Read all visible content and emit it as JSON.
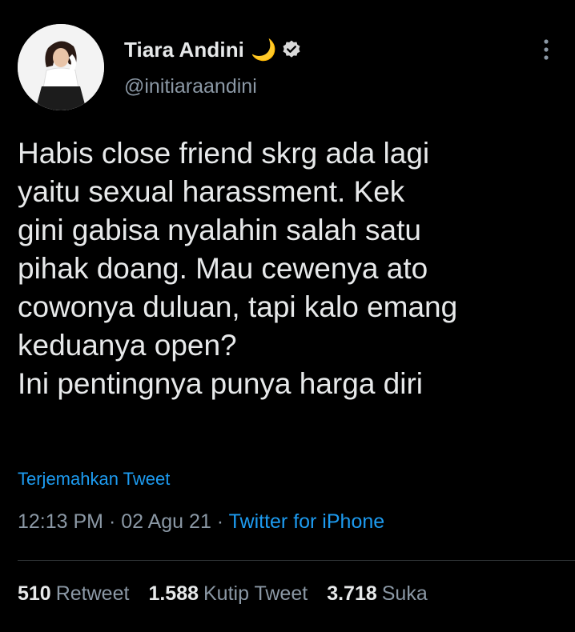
{
  "author": {
    "display_name": "Tiara Andini",
    "emoji": "🌙",
    "handle": "@initiaraandini"
  },
  "tweet": {
    "lines": [
      "Habis close friend skrg ada lagi",
      "yaitu sexual harassment. Kek",
      "gini gabisa nyalahin salah satu",
      "pihak doang. Mau cewenya ato",
      "cowonya duluan, tapi kalo emang",
      "keduanya open?",
      "Ini pentingnya punya harga diri"
    ],
    "translate_label": "Terjemahkan Tweet",
    "time": "12:13 PM",
    "date": "02 Agu 21",
    "separator": " · ",
    "source": "Twitter for iPhone"
  },
  "stats": {
    "retweets": {
      "count": "510",
      "label": "Retweet"
    },
    "quotes": {
      "count": "1.588",
      "label": "Kutip Tweet"
    },
    "likes": {
      "count": "3.718",
      "label": "Suka"
    }
  },
  "icons": {
    "verified": "verified-badge-icon",
    "more": "more-vertical-icon",
    "moon": "crescent-moon-icon"
  },
  "colors": {
    "background": "#000000",
    "text": "#e7e9ea",
    "secondary": "#8b98a5",
    "link": "#1d9bf0",
    "moon": "#f4c430"
  }
}
